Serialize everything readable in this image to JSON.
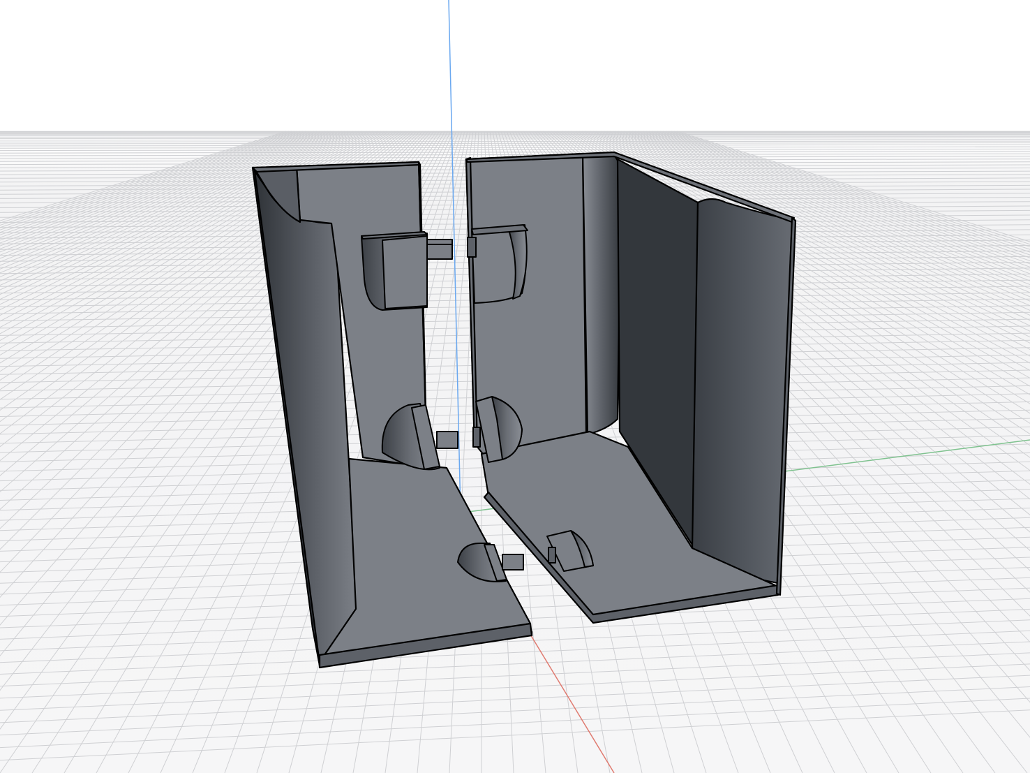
{
  "viewport": {
    "background_sky": "#ffffff",
    "background_floor": "#f2f2f3",
    "grid_line_color": "#cfd0d3",
    "axis_colors": {
      "x": "#e07b70",
      "y": "#7fc28f",
      "z": "#6aa8f0"
    }
  },
  "model": {
    "body_color": "#7c8087",
    "dark_color": "#30343a",
    "edge_color": "#000000",
    "parts": [
      "left-half-shell",
      "right-half-shell"
    ]
  }
}
